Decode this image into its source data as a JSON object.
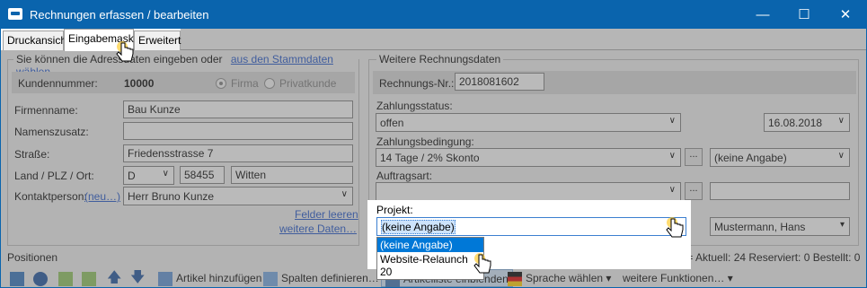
{
  "window": {
    "title": "Rechnungen erfassen / bearbeiten",
    "controls": [
      "—",
      "☐",
      "✕"
    ]
  },
  "tabs": [
    {
      "label": "Druckansicht"
    },
    {
      "label": "Eingabemaske"
    },
    {
      "label": "Erweitert"
    }
  ],
  "address": {
    "group_intro": "Sie können die Adressdaten eingeben oder",
    "stammdaten_link": "aus den Stammdaten wählen…",
    "customer_number_label": "Kundennummer:",
    "customer_number": "10000",
    "type_firma": "Firma",
    "type_privat": "Privatkunde",
    "company_label": "Firmenname:",
    "company": "Bau Kunze",
    "name_extra_label": "Namenszusatz:",
    "name_extra": "",
    "street_label": "Straße:",
    "street": "Friedensstrasse 7",
    "location_label": "Land / PLZ / Ort:",
    "country": "D",
    "zip": "58455",
    "city": "Witten",
    "contact_label": "Kontaktperson:",
    "contact_new": "(neu…)",
    "contact": "Herr Bruno Kunze",
    "clear_fields": "Felder leeren",
    "more_data": "weitere Daten…"
  },
  "invoice": {
    "group_title": "Weitere Rechnungsdaten",
    "number_label": "Rechnungs-Nr.:",
    "number": "2018081602",
    "status_label": "Zahlungsstatus:",
    "status": "offen",
    "date": "16.08.2018",
    "terms_label": "Zahlungsbedingung:",
    "terms": "14 Tage / 2% Skonto",
    "terms_btn": "...",
    "terms_extra": "(keine Angabe)",
    "order_type_label": "Auftragsart:",
    "order_type": "",
    "order_btn": "...",
    "project_label": "Projekt:",
    "project": "(keine Angabe)",
    "project_options": [
      "(keine Angabe)",
      "Website-Relaunch 20"
    ],
    "employee": "Mustermann, Hans"
  },
  "positions": {
    "label": "Positionen",
    "stock_status": "r = Aktuell: 24   Reserviert: 0   Bestellt: 0"
  },
  "toolbar": {
    "add_article": "Artikel hinzufügen",
    "define_columns": "Spalten definieren…",
    "show_article_list": "Artikelliste einblenden",
    "choose_language": "Sprache wählen",
    "more_functions": "weitere Funktionen…"
  }
}
